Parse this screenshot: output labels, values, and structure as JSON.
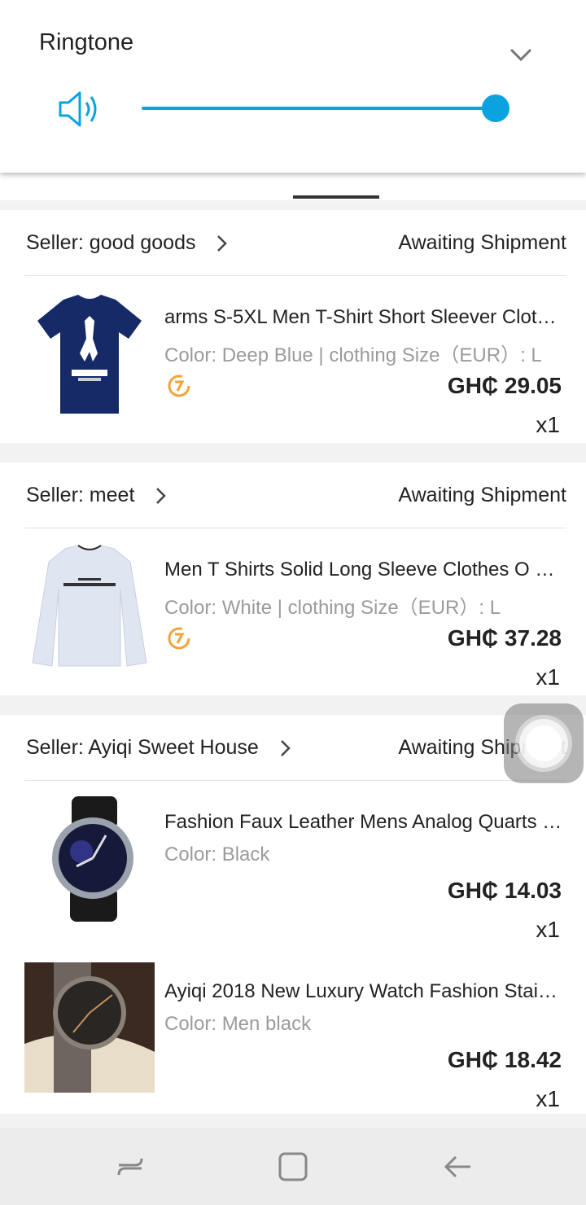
{
  "volume_panel": {
    "title": "Ringtone",
    "level_percent": 100,
    "accent_color": "#0aa3e0",
    "icons": [
      "speaker-icon",
      "chevron-down-icon"
    ]
  },
  "orders": [
    {
      "seller": "Seller: good goods",
      "status": "Awaiting Shipment",
      "items": [
        {
          "title": " arms  S-5XL Men T-Shirt Short Sleever Clot…",
          "variant": "Color: Deep Blue | clothing Size（EUR）: L",
          "price": "GH₵  29.05",
          "qty": "x1",
          "image": "navy-tshirt-call-of-duty",
          "refund_icon": true
        }
      ]
    },
    {
      "seller": "Seller: meet",
      "status": "Awaiting Shipment",
      "items": [
        {
          "title": "Men T Shirts Solid Long Sleeve Clothes O N…",
          "variant": "Color: White | clothing Size（EUR）: L",
          "price": "GH₵  37.28",
          "qty": "x1",
          "image": "white-long-sleeve-chaos",
          "refund_icon": true
        }
      ]
    },
    {
      "seller": "Seller: Ayiqi Sweet House",
      "status": "Awaiting Shipment",
      "items": [
        {
          "title": "Fashion Faux Leather Mens Analog Quarts …",
          "variant": "Color: Black",
          "price": "GH₵  14.03",
          "qty": "x1",
          "image": "black-leather-watch"
        },
        {
          "title": "Ayiqi 2018 New Luxury Watch Fashion Stainl…",
          "variant": "Color: Men black",
          "price": "GH₵  18.42",
          "qty": "x1",
          "image": "steel-watch-in-box"
        }
      ]
    }
  ],
  "nav_bar": {
    "buttons": [
      "recents-icon",
      "home-icon",
      "back-icon"
    ]
  }
}
